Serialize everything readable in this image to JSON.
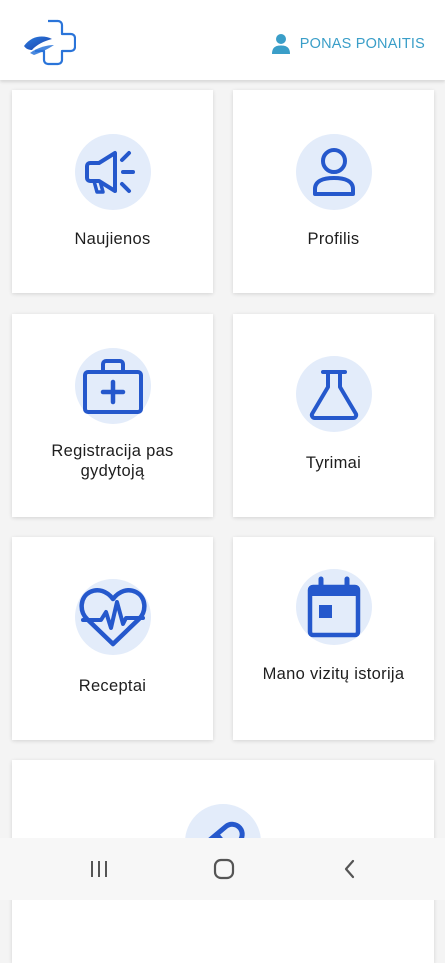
{
  "header": {
    "logo_icon": "medical-cross-logo",
    "user_icon": "person-icon",
    "user_name": "PONAS PONAITIS"
  },
  "tiles": [
    {
      "label": "Naujienos",
      "icon": "megaphone-icon"
    },
    {
      "label": "Profilis",
      "icon": "person-icon"
    },
    {
      "label": "Registracija pas gydytoją",
      "icon": "first-aid-kit-icon"
    },
    {
      "label": "Tyrimai",
      "icon": "flask-icon"
    },
    {
      "label": "Receptai",
      "icon": "heart-pulse-icon"
    },
    {
      "label": "Mano vizitų istorija",
      "icon": "calendar-icon"
    },
    {
      "label": "",
      "icon": "pill-icon"
    }
  ],
  "navbar": {
    "recent_icon": "recent-apps-icon",
    "home_icon": "home-icon",
    "back_icon": "back-icon"
  },
  "colors": {
    "accent": "#2558cc",
    "icon_bg": "#e3ecfa",
    "user_text": "#3a9ec8",
    "page_bg": "#f4f4f4"
  }
}
